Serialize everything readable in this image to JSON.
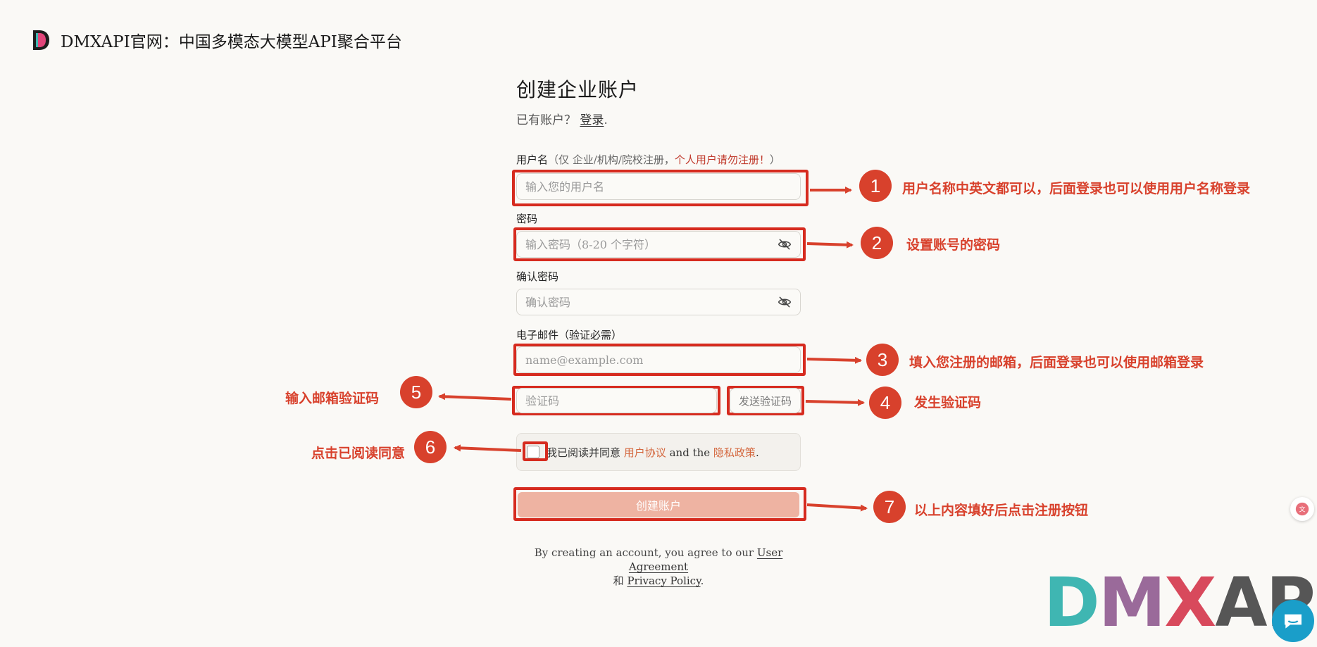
{
  "header": {
    "site_title": "DMXAPI官网：中国多模态大模型API聚合平台"
  },
  "form": {
    "title": "创建企业账户",
    "have_account": "已有账户？",
    "login_link": "登录",
    "login_suffix": ".",
    "username_label": "用户名",
    "username_hint": "（仅 企业/机构/院校注册，",
    "username_warn": "个人用户请勿注册！",
    "username_hint_end": "）",
    "username_placeholder": "输入您的用户名",
    "password_label": "密码",
    "password_placeholder": "输入密码（8-20 个字符）",
    "confirm_label": "确认密码",
    "confirm_placeholder": "确认密码",
    "email_label": "电子邮件（验证必需）",
    "email_placeholder": "name@example.com",
    "code_placeholder": "验证码",
    "send_code_label": "发送验证码",
    "agree_prefix": "我已阅读并同意",
    "agree_link1": "用户协议",
    "agree_mid": "and the",
    "agree_link2": "隐私政策",
    "agree_suffix": ".",
    "submit_label": "创建账户",
    "submit_color": "#eeb3a2",
    "terms_line1_prefix": "By creating an account, you agree to our",
    "terms_link1": "User Agreement",
    "terms_line2_prefix": "和",
    "terms_link2": "Privacy Policy",
    "terms_suffix": "."
  },
  "annotations": [
    {
      "num": "1",
      "text": "用户名称中英文都可以，后面登录也可以使用用户名称登录"
    },
    {
      "num": "2",
      "text": "设置账号的密码"
    },
    {
      "num": "3",
      "text": "填入您注册的邮箱，后面登录也可以使用邮箱登录"
    },
    {
      "num": "4",
      "text": "发生验证码"
    },
    {
      "num": "5",
      "text": "输入邮箱验证码"
    },
    {
      "num": "6",
      "text": "点击已阅读同意"
    },
    {
      "num": "7",
      "text": "以上内容填好后点击注册按钮"
    }
  ],
  "watermark": {
    "p1": "D",
    "p2": "M",
    "p3": "X",
    "p4": "API"
  },
  "colors": {
    "accent": "#d8412c",
    "annotation_box": "#d62b1f",
    "link": "#d4683f"
  },
  "icons": {
    "eye": "eye-off-icon",
    "chat": "chat-bubble-icon",
    "translate": "translate-icon",
    "logo": "dmx-logo-icon"
  }
}
